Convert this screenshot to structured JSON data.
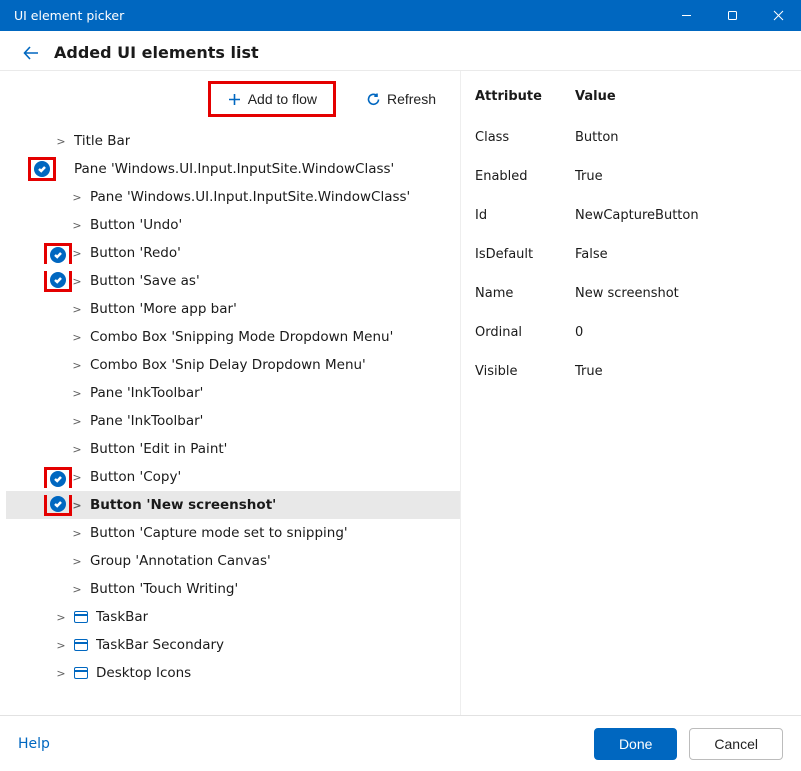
{
  "window": {
    "title": "UI element picker"
  },
  "breadcrumb": {
    "title": "Added UI elements list"
  },
  "toolbar": {
    "add_to_flow_label": "Add to flow",
    "refresh_label": "Refresh"
  },
  "tree": [
    {
      "level": 0,
      "checked": false,
      "highlightCheck": false,
      "expander": ">",
      "hasWin": false,
      "label": "Title Bar",
      "selected": false
    },
    {
      "level": 0,
      "checked": true,
      "highlightCheck": true,
      "expander": "",
      "hasWin": false,
      "label": "Pane 'Windows.UI.Input.InputSite.WindowClass'",
      "selected": false
    },
    {
      "level": 1,
      "checked": false,
      "highlightCheck": false,
      "expander": ">",
      "hasWin": false,
      "label": "Pane 'Windows.UI.Input.InputSite.WindowClass'",
      "selected": false
    },
    {
      "level": 1,
      "checked": false,
      "highlightCheck": false,
      "expander": ">",
      "hasWin": false,
      "label": "Button 'Undo'",
      "selected": false
    },
    {
      "level": 1,
      "checked": true,
      "highlightCheck": true,
      "expander": ">",
      "hasWin": false,
      "label": "Button 'Redo'",
      "selected": false
    },
    {
      "level": 1,
      "checked": true,
      "highlightCheck": true,
      "expander": ">",
      "hasWin": false,
      "label": "Button 'Save as'",
      "selected": false
    },
    {
      "level": 1,
      "checked": false,
      "highlightCheck": false,
      "expander": ">",
      "hasWin": false,
      "label": "Button 'More app bar'",
      "selected": false
    },
    {
      "level": 1,
      "checked": false,
      "highlightCheck": false,
      "expander": ">",
      "hasWin": false,
      "label": "Combo Box 'Snipping Mode Dropdown Menu'",
      "selected": false
    },
    {
      "level": 1,
      "checked": false,
      "highlightCheck": false,
      "expander": ">",
      "hasWin": false,
      "label": "Combo Box 'Snip Delay Dropdown Menu'",
      "selected": false
    },
    {
      "level": 1,
      "checked": false,
      "highlightCheck": false,
      "expander": ">",
      "hasWin": false,
      "label": "Pane 'InkToolbar'",
      "selected": false
    },
    {
      "level": 1,
      "checked": false,
      "highlightCheck": false,
      "expander": ">",
      "hasWin": false,
      "label": "Pane 'InkToolbar'",
      "selected": false
    },
    {
      "level": 1,
      "checked": false,
      "highlightCheck": false,
      "expander": ">",
      "hasWin": false,
      "label": "Button 'Edit in Paint'",
      "selected": false
    },
    {
      "level": 1,
      "checked": true,
      "highlightCheck": true,
      "expander": ">",
      "hasWin": false,
      "label": "Button 'Copy'",
      "selected": false
    },
    {
      "level": 1,
      "checked": true,
      "highlightCheck": true,
      "expander": ">",
      "hasWin": false,
      "label": "Button 'New screenshot'",
      "selected": true
    },
    {
      "level": 1,
      "checked": false,
      "highlightCheck": false,
      "expander": ">",
      "hasWin": false,
      "label": "Button 'Capture mode set to snipping'",
      "selected": false
    },
    {
      "level": 1,
      "checked": false,
      "highlightCheck": false,
      "expander": ">",
      "hasWin": false,
      "label": "Group 'Annotation Canvas'",
      "selected": false
    },
    {
      "level": 1,
      "checked": false,
      "highlightCheck": false,
      "expander": ">",
      "hasWin": false,
      "label": "Button 'Touch Writing'",
      "selected": false
    },
    {
      "level": 0,
      "checked": false,
      "highlightCheck": false,
      "expander": ">",
      "hasWin": true,
      "label": "TaskBar",
      "selected": false
    },
    {
      "level": 0,
      "checked": false,
      "highlightCheck": false,
      "expander": ">",
      "hasWin": true,
      "label": "TaskBar Secondary",
      "selected": false
    },
    {
      "level": 0,
      "checked": false,
      "highlightCheck": false,
      "expander": ">",
      "hasWin": true,
      "label": "Desktop Icons",
      "selected": false
    }
  ],
  "props": {
    "header": {
      "attr": "Attribute",
      "val": "Value"
    },
    "rows": [
      {
        "attr": "Class",
        "val": "Button"
      },
      {
        "attr": "Enabled",
        "val": "True"
      },
      {
        "attr": "Id",
        "val": "NewCaptureButton"
      },
      {
        "attr": "IsDefault",
        "val": "False"
      },
      {
        "attr": "Name",
        "val": "New screenshot"
      },
      {
        "attr": "Ordinal",
        "val": "0"
      },
      {
        "attr": "Visible",
        "val": "True"
      }
    ]
  },
  "footer": {
    "help_label": "Help",
    "done_label": "Done",
    "cancel_label": "Cancel"
  }
}
